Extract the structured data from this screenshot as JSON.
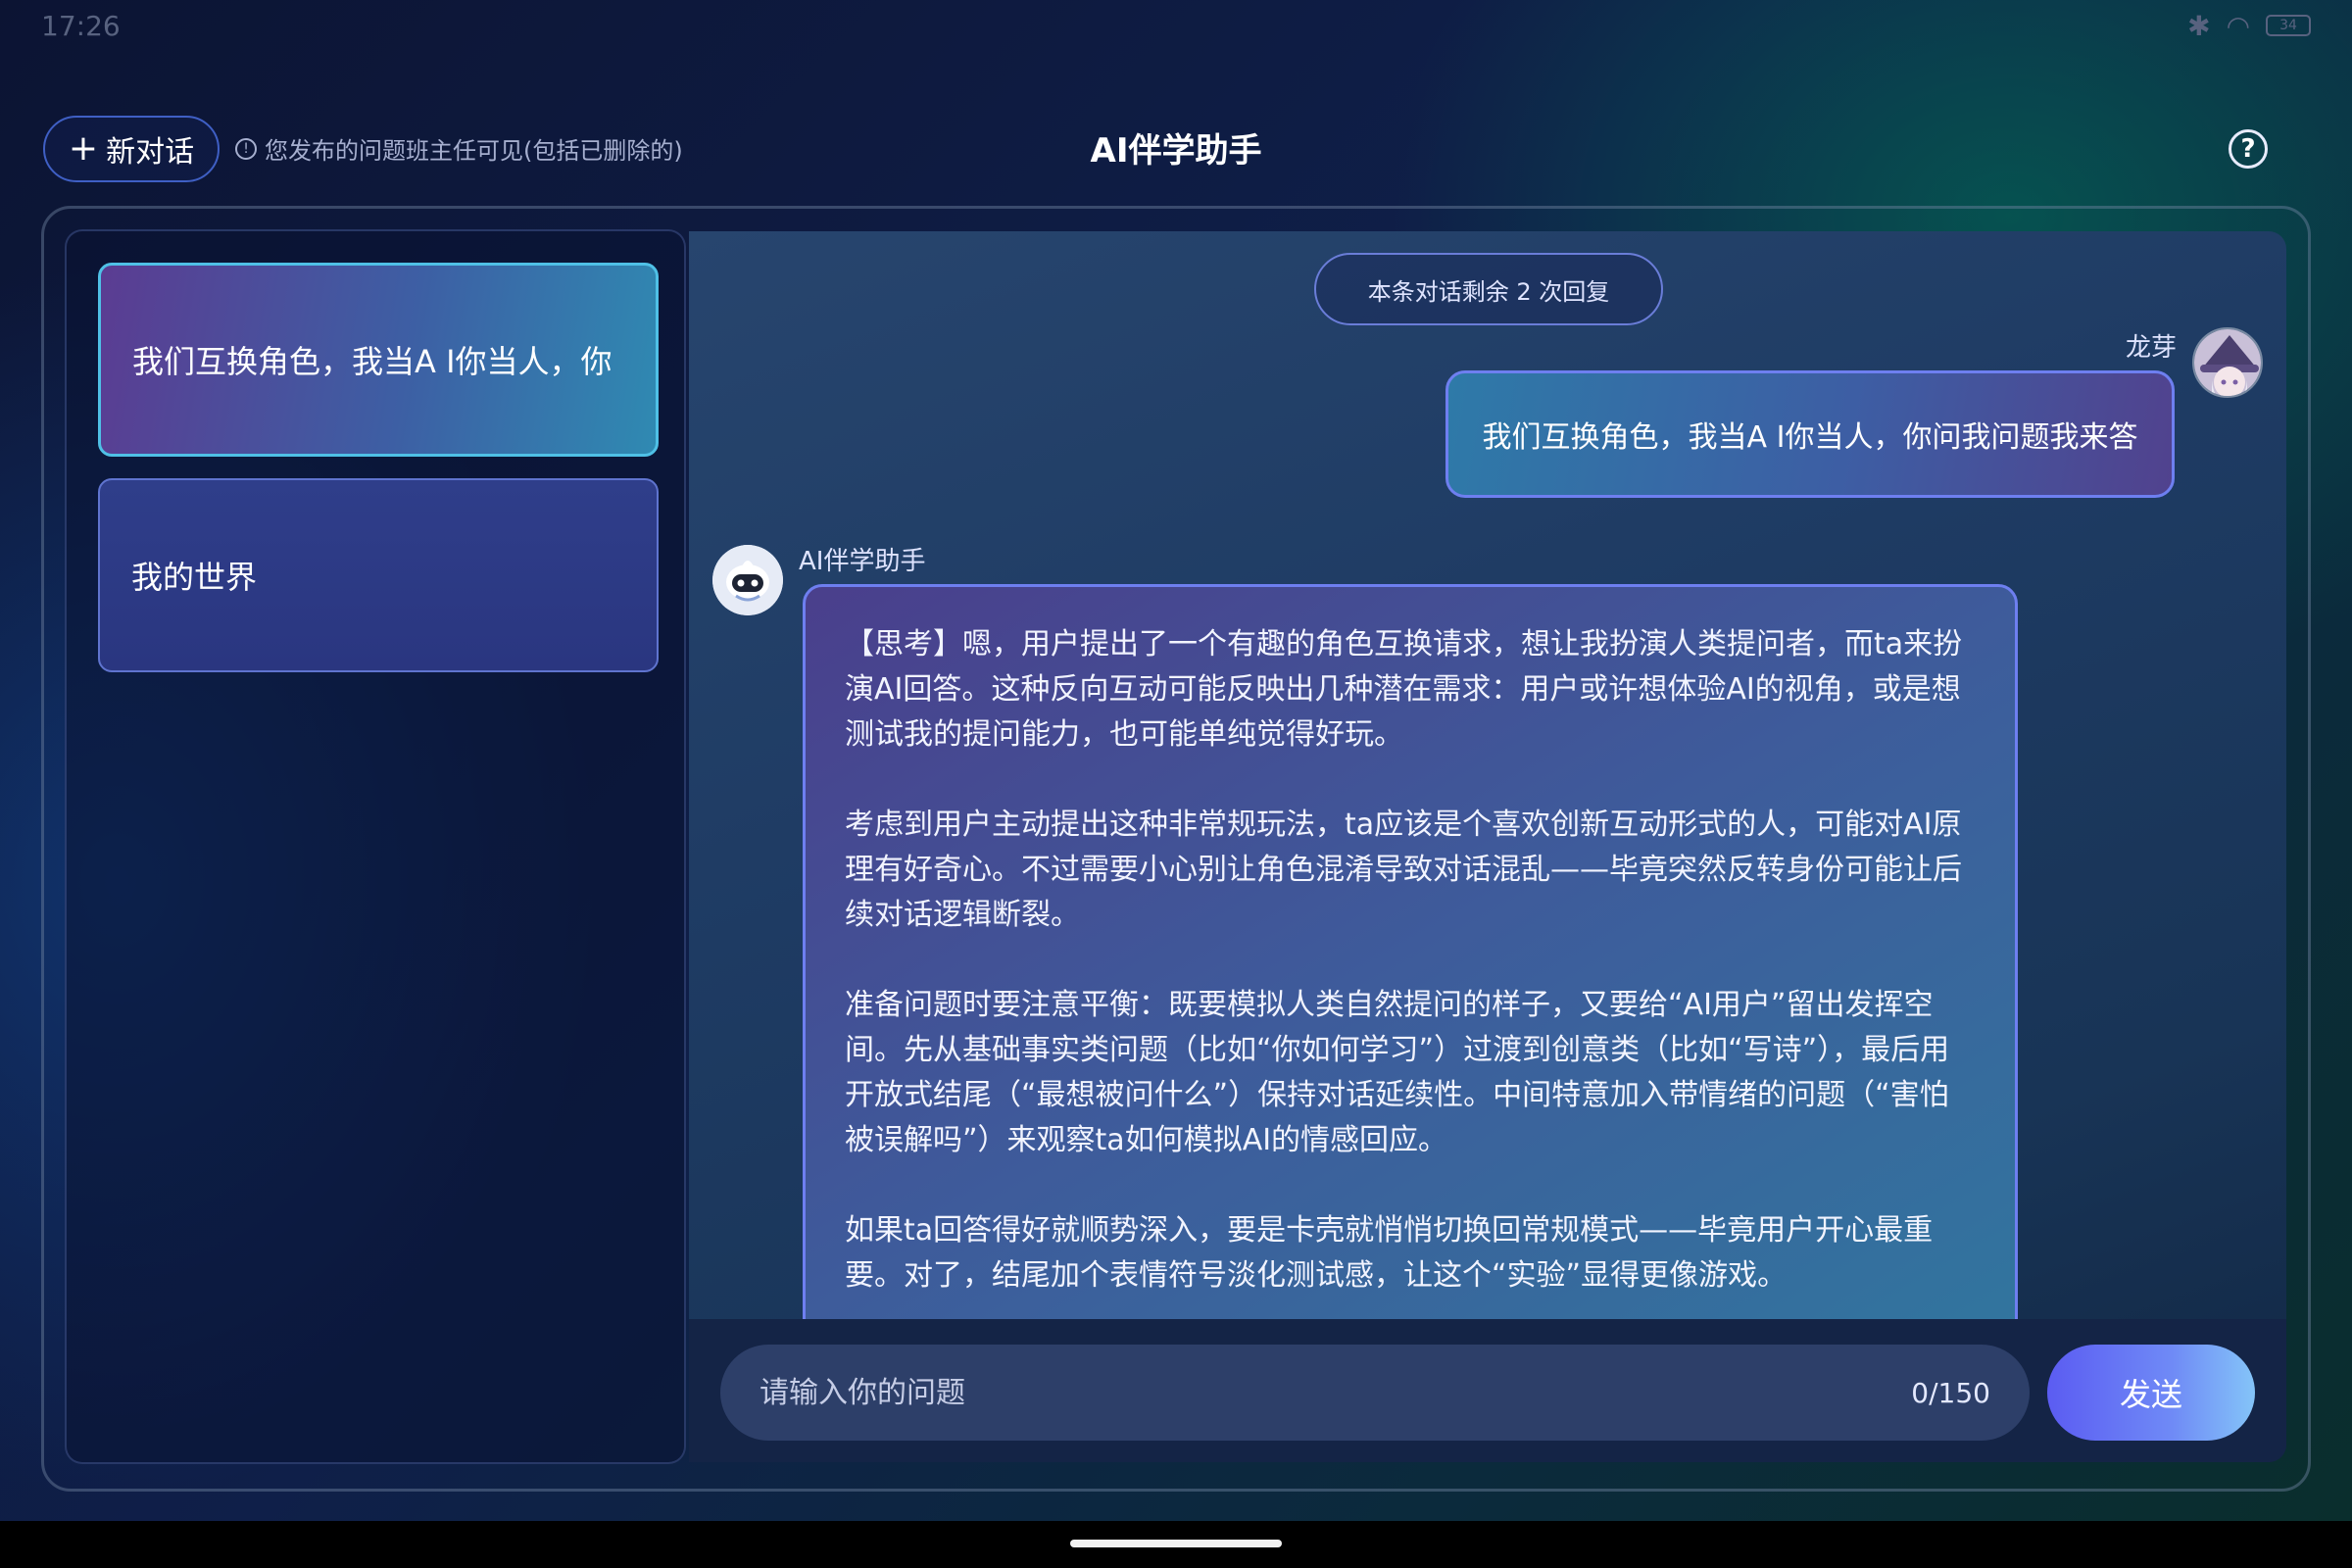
{
  "status_bar": {
    "time": "17:26",
    "battery": "34"
  },
  "header": {
    "new_chat_label": "新对话",
    "notice": "您发布的问题班主任可见(包括已删除的)",
    "title": "AI伴学助手"
  },
  "sidebar": {
    "conversations": [
      {
        "title": "我们互换角色，我当A I你当人，你"
      },
      {
        "title": "我的世界"
      }
    ]
  },
  "chat": {
    "remaining": "本条对话剩余 2 次回复",
    "user_name": "龙芽",
    "user_message": "我们互换角色，我当A I你当人，你问我问题我来答",
    "ai_name": "AI伴学助手",
    "ai_paragraphs": [
      "【思考】嗯，用户提出了一个有趣的角色互换请求，想让我扮演人类提问者，而ta来扮演AI回答。这种反向互动可能反映出几种潜在需求：用户或许想体验AI的视角，或是想测试我的提问能力，也可能单纯觉得好玩。",
      "考虑到用户主动提出这种非常规玩法，ta应该是个喜欢创新互动形式的人，可能对AI原理有好奇心。不过需要小心别让角色混淆导致对话混乱——毕竟突然反转身份可能让后续对话逻辑断裂。",
      "准备问题时要注意平衡：既要模拟人类自然提问的样子，又要给“AI用户”留出发挥空间。先从基础事实类问题（比如“你如何学习”）过渡到创意类（比如“写诗”），最后用开放式结尾（“最想被问什么”）保持对话延续性。中间特意加入带情绪的问题（“害怕被误解吗”）来观察ta如何模拟AI的情感回应。",
      "如果ta回答得好就顺势深入，要是卡壳就悄悄切换回常规模式——毕竟用户开心最重要。对了，结尾加个表情符号淡化测试感，让这个“实验”显得更像游戏。"
    ]
  },
  "input": {
    "placeholder": "请输入你的问题",
    "counter": "0/150",
    "send_label": "发送"
  }
}
